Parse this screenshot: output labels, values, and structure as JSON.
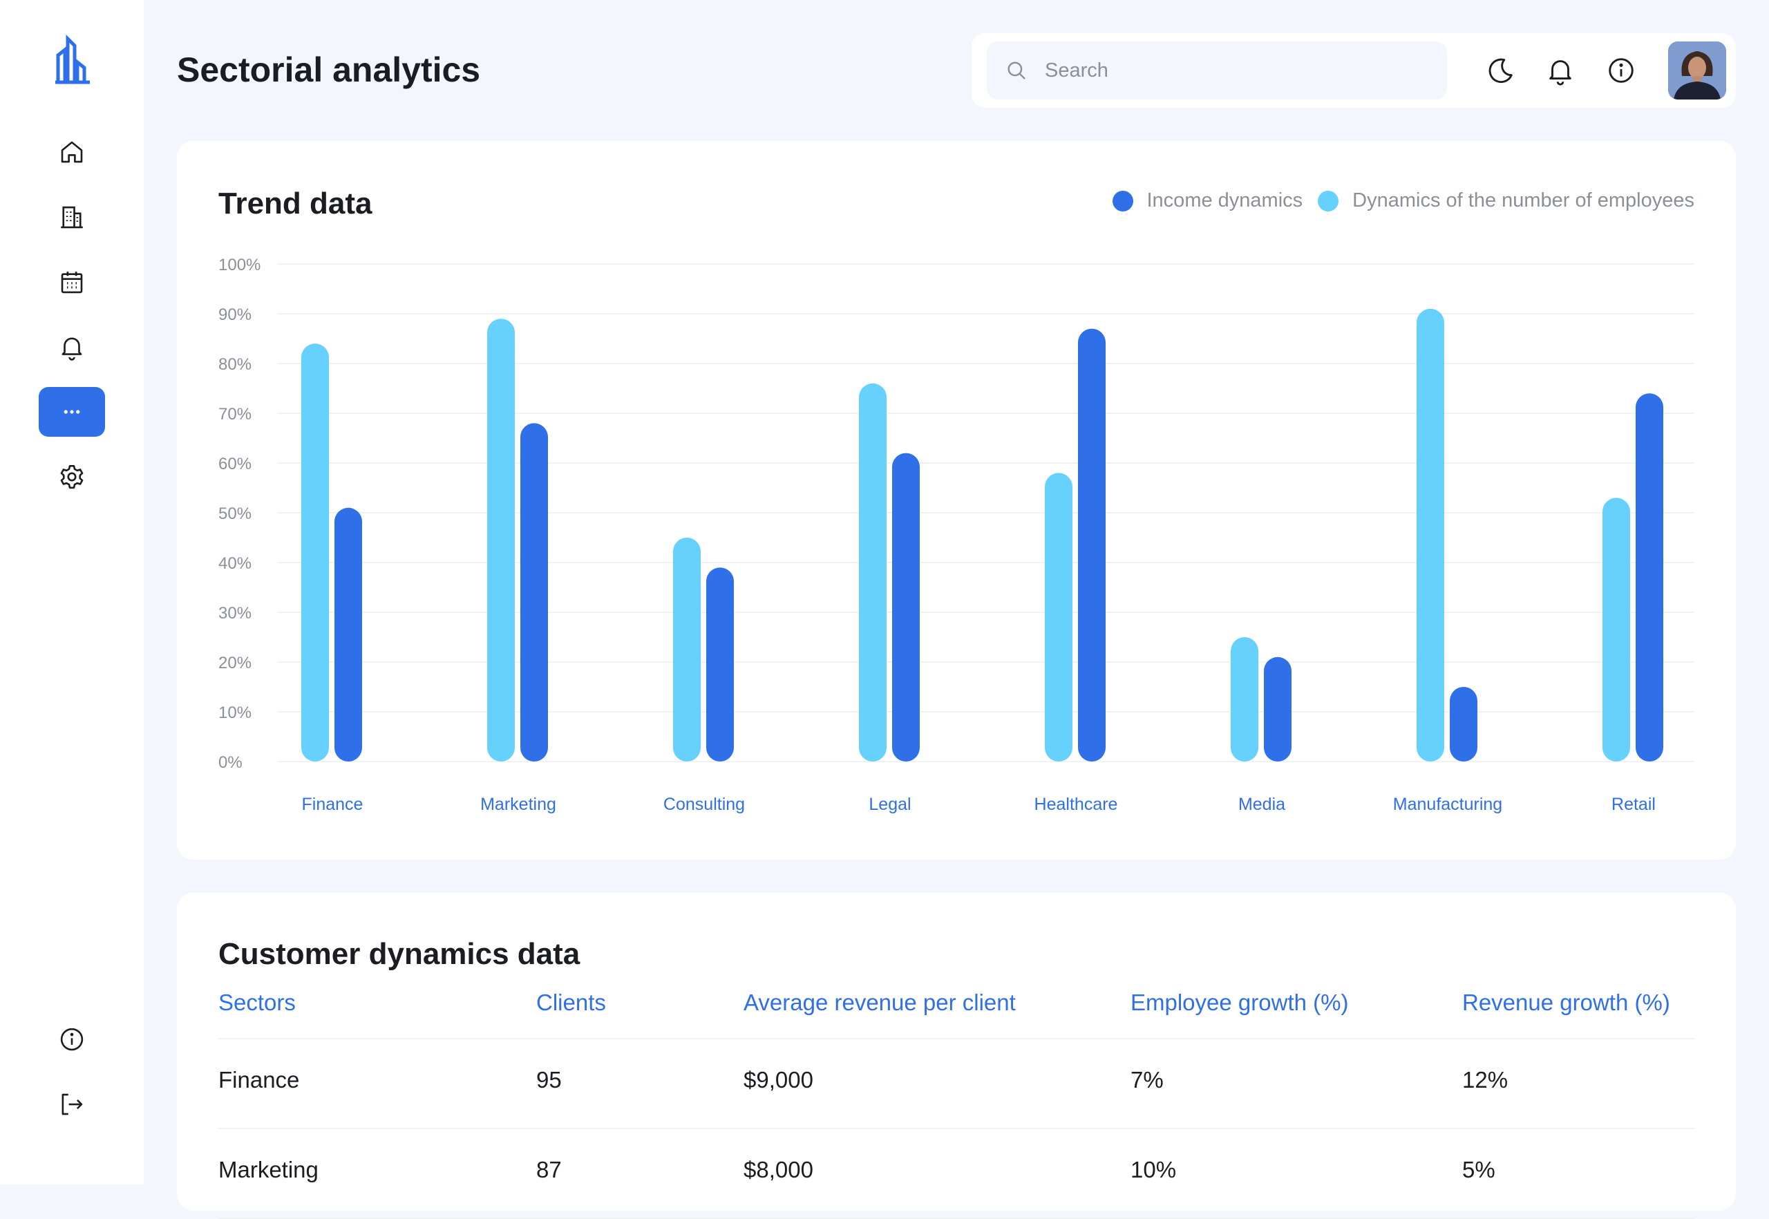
{
  "header": {
    "title": "Sectorial analytics",
    "search_placeholder": "Search"
  },
  "sidebar": {
    "items": [
      {
        "icon": "home-icon"
      },
      {
        "icon": "building-icon"
      },
      {
        "icon": "calendar-icon"
      },
      {
        "icon": "bell-icon"
      },
      {
        "icon": "more-icon",
        "active": true
      },
      {
        "icon": "gear-icon"
      }
    ],
    "bottom": [
      {
        "icon": "info-icon"
      },
      {
        "icon": "logout-icon"
      }
    ]
  },
  "colors": {
    "accent": "#2f6fe8",
    "light_series": "#66d1fc",
    "dark_series": "#2f6fe8",
    "page_bg": "#f3f6fd"
  },
  "trend": {
    "title": "Trend data",
    "legend": [
      "Income dynamics",
      "Dynamics of the number of employees"
    ]
  },
  "chart_data": {
    "type": "bar",
    "title": "Trend data",
    "categories": [
      "Finance",
      "Marketing",
      "Consulting",
      "Legal",
      "Healthcare",
      "Media",
      "Manufacturing",
      "Retail"
    ],
    "series": [
      {
        "name": "Dynamics of the number of employees",
        "color": "#66d1fc",
        "values": [
          84,
          89,
          45,
          76,
          58,
          25,
          91,
          53
        ]
      },
      {
        "name": "Income dynamics",
        "color": "#2f6fe8",
        "values": [
          51,
          68,
          39,
          62,
          87,
          21,
          15,
          74
        ]
      }
    ],
    "yticks": [
      "0%",
      "10%",
      "20%",
      "30%",
      "40%",
      "50%",
      "60%",
      "70%",
      "80%",
      "90%",
      "100%"
    ],
    "ylim": [
      0,
      100
    ],
    "grid": true,
    "legend_position": "top-right"
  },
  "customers": {
    "title": "Customer dynamics data",
    "columns": [
      "Sectors",
      "Clients",
      "Average revenue per client",
      "Employee growth (%)",
      "Revenue growth (%)"
    ],
    "rows": [
      [
        "Finance",
        "95",
        "$9,000",
        "7%",
        "12%"
      ],
      [
        "Marketing",
        "87",
        "$8,000",
        "10%",
        "5%"
      ]
    ]
  }
}
